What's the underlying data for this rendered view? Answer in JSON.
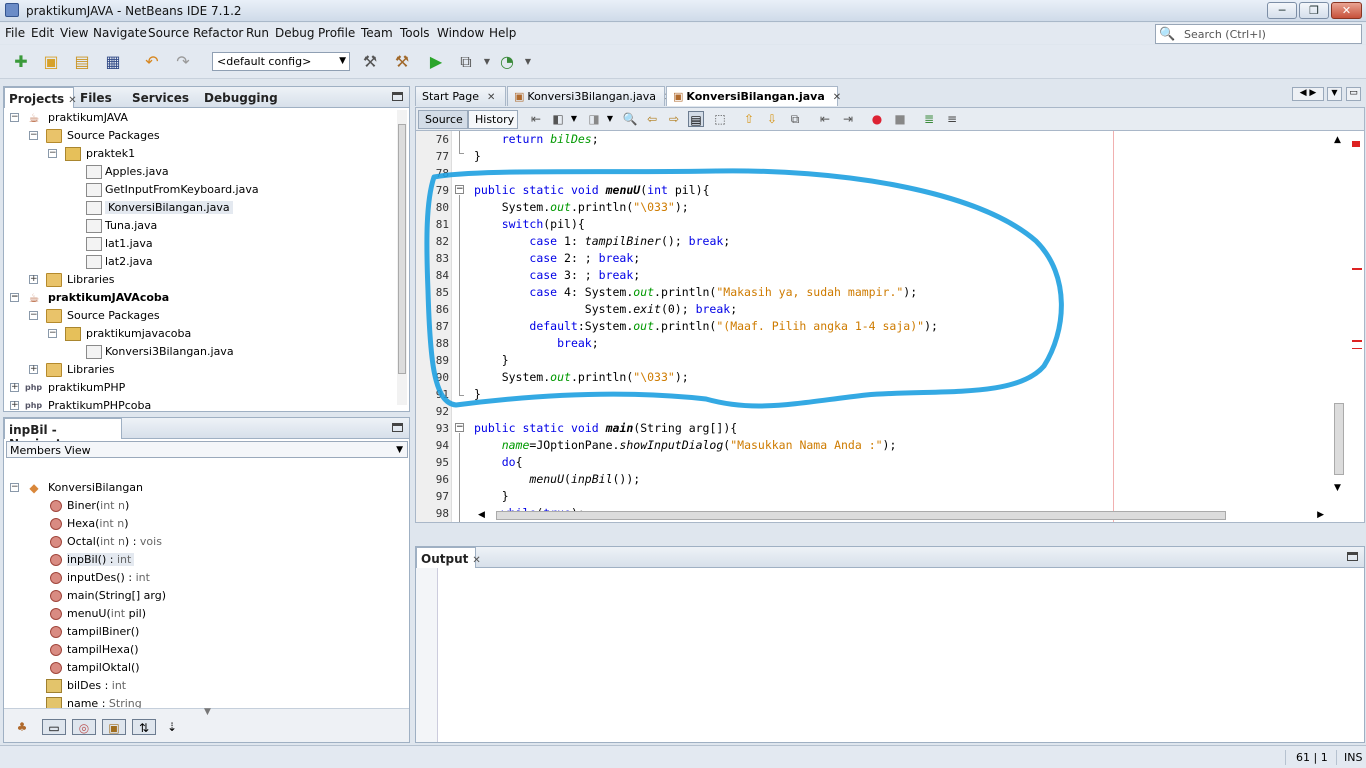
{
  "window": {
    "title": "praktikumJAVA - NetBeans IDE 7.1.2",
    "controls": {
      "minimize": "─",
      "maximize": "❐",
      "close": "✕"
    }
  },
  "menubar": {
    "items": [
      "File",
      "Edit",
      "View",
      "Navigate",
      "Source",
      "Refactor",
      "Run",
      "Debug",
      "Profile",
      "Team",
      "Tools",
      "Window",
      "Help"
    ],
    "search_placeholder": "Search (Ctrl+I)"
  },
  "toolbar": {
    "config_value": "<default config>"
  },
  "projects_panel": {
    "tabs": [
      "Projects",
      "Files",
      "Services",
      "Debugging"
    ],
    "close_glyph": "✕",
    "tree": [
      {
        "label": "praktikumJAVA",
        "level": 0
      },
      {
        "label": "Source Packages",
        "level": 1
      },
      {
        "label": "praktek1",
        "level": 2
      },
      {
        "label": "Apples.java",
        "level": 3
      },
      {
        "label": "GetInputFromKeyboard.java",
        "level": 3
      },
      {
        "label": "KonversiBilangan.java",
        "level": 3
      },
      {
        "label": "Tuna.java",
        "level": 3
      },
      {
        "label": "lat1.java",
        "level": 3
      },
      {
        "label": "lat2.java",
        "level": 3
      },
      {
        "label": "Libraries",
        "level": 1
      },
      {
        "label": "praktikumJAVAcoba",
        "level": 0
      },
      {
        "label": "Source Packages",
        "level": 1
      },
      {
        "label": "praktikumjavacoba",
        "level": 2
      },
      {
        "label": "Konversi3Bilangan.java",
        "level": 3
      },
      {
        "label": "Libraries",
        "level": 1
      },
      {
        "label": "praktikumPHP",
        "level": 0
      },
      {
        "label": "PraktikumPHPcoba",
        "level": 0
      }
    ]
  },
  "navigator_panel": {
    "title": "inpBil - Navigator",
    "view": "Members View",
    "class_name": "KonversiBilangan",
    "members": [
      {
        "name": "Biner(",
        "params": "int n",
        "close": ")",
        "type": ""
      },
      {
        "name": "Hexa(",
        "params": "int n",
        "close": ")",
        "type": ""
      },
      {
        "name": "Octal(",
        "params": "int n",
        "close": ") : ",
        "type": "vois"
      },
      {
        "name": "inpBil()",
        "params": "",
        "close": " : ",
        "type": "int"
      },
      {
        "name": "inputDes()",
        "params": "",
        "close": " : ",
        "type": "int"
      },
      {
        "name": "main(String[] arg)",
        "params": "",
        "close": "",
        "type": ""
      },
      {
        "name": "menuU(",
        "params": "int",
        "close": " pil)",
        "type": ""
      },
      {
        "name": "tampilBiner()",
        "params": "",
        "close": "",
        "type": ""
      },
      {
        "name": "tampilHexa()",
        "params": "",
        "close": "",
        "type": ""
      },
      {
        "name": "tampilOktal()",
        "params": "",
        "close": "",
        "type": ""
      },
      {
        "name": "bilDes",
        "params": "",
        "close": " : ",
        "type": "int"
      },
      {
        "name": "name",
        "params": "",
        "close": " : ",
        "type": "String"
      }
    ]
  },
  "editor": {
    "tabs": [
      "Start Page",
      "Konversi3Bilangan.java",
      "KonversiBilangan.java"
    ],
    "active_tab": "KonversiBilangan.java",
    "views": [
      "Source",
      "History"
    ],
    "lines": [
      {
        "n": "76",
        "code": "    return bilDes;"
      },
      {
        "n": "77",
        "code": "}"
      },
      {
        "n": "78",
        "code": ""
      },
      {
        "n": "79",
        "code": "public static void menuU(int pil){"
      },
      {
        "n": "80",
        "code": "    System.out.println(\"\\033\");"
      },
      {
        "n": "81",
        "code": "    switch(pil){"
      },
      {
        "n": "82",
        "code": "        case 1: tampilBiner(); break;"
      },
      {
        "n": "83",
        "code": "        case 2: ; break;"
      },
      {
        "n": "84",
        "code": "        case 3: ; break;"
      },
      {
        "n": "85",
        "code": "        case 4: System.out.println(\"Makasih ya, sudah mampir.\");"
      },
      {
        "n": "86",
        "code": "                System.exit(0); break;"
      },
      {
        "n": "87",
        "code": "        default:System.out.println(\"(Maaf. Pilih angka 1-4 saja)\");"
      },
      {
        "n": "88",
        "code": "            break;"
      },
      {
        "n": "89",
        "code": "    }"
      },
      {
        "n": "90",
        "code": "    System.out.println(\"\\033\");"
      },
      {
        "n": "91",
        "code": "}"
      },
      {
        "n": "92",
        "code": ""
      },
      {
        "n": "93",
        "code": "public static void main(String arg[]){"
      },
      {
        "n": "94",
        "code": "    name=JOptionPane.showInputDialog(\"Masukkan Nama Anda :\");"
      },
      {
        "n": "95",
        "code": "    do{"
      },
      {
        "n": "96",
        "code": "        menuU(inpBil());"
      },
      {
        "n": "97",
        "code": "    }"
      },
      {
        "n": "98",
        "code": "    while(true);"
      }
    ]
  },
  "output_panel": {
    "title": "Output"
  },
  "statusbar": {
    "position": "61 | 1",
    "mode": "INS"
  },
  "colors": {
    "annotation": "#1ea0e0"
  }
}
